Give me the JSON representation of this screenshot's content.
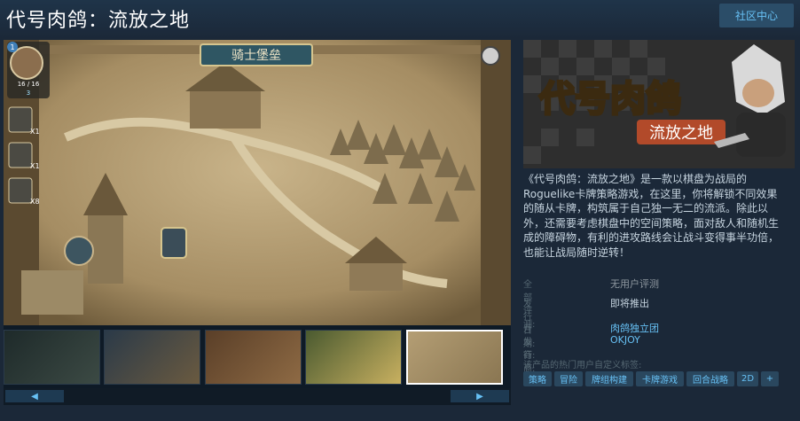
{
  "header": {
    "title": "代号肉鸽：流放之地",
    "community_button": "社区中心"
  },
  "media": {
    "map_banner": "骑士堡垒",
    "hud": {
      "level": "1",
      "hp": "16 / 16",
      "mana": "3",
      "item_count_1": "X1",
      "item_count_2": "X1",
      "item_count_3": "X8"
    }
  },
  "capsule": {
    "title_line1": "代号肉鸽",
    "title_line2": "流放之地"
  },
  "description": "《代号肉鸽：流放之地》是一款以棋盘为战局的Roguelike卡牌策略游戏，在这里，你将解锁不同效果的随从卡牌，构筑属于自己独一无二的流派。除此以外，还需要考虑棋盘中的空间策略，面对敌人和随机生成的障碍物，有利的进攻路线会让战斗变得事半功倍，也能让战局随时逆转！",
  "meta": {
    "reviews_label": "全部评测:",
    "reviews_value": "无用户评测",
    "release_label": "发行日期:",
    "release_value": "即将推出",
    "developer_label": "开发商:",
    "developer_value": "肉鸽独立团",
    "publisher_label": "发行商:",
    "publisher_value": "OKJOY"
  },
  "tags": {
    "label": "该产品的热门用户自定义标签:",
    "items": [
      "策略",
      "冒险",
      "牌组构建",
      "卡牌游戏",
      "回合战略",
      "2D",
      "+"
    ]
  },
  "scroll": {
    "left": "◀",
    "right": "▶"
  }
}
